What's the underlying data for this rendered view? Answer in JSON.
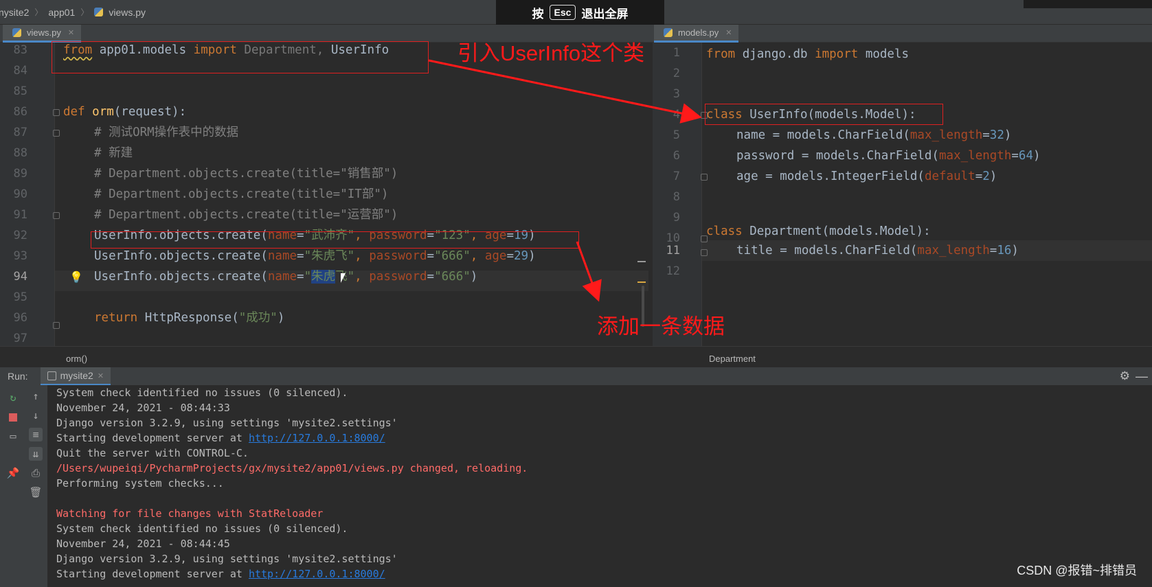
{
  "breadcrumb": {
    "project": "nysite2",
    "folder": "app01",
    "file": "views.py"
  },
  "overlay": {
    "press": "按",
    "key": "Esc",
    "action": "退出全屏"
  },
  "tabs": {
    "left": "views.py",
    "right": "models.py"
  },
  "left_editor": {
    "lines": [
      {
        "n": "83"
      },
      {
        "n": "84"
      },
      {
        "n": "85"
      },
      {
        "n": "86"
      },
      {
        "n": "87"
      },
      {
        "n": "88"
      },
      {
        "n": "89"
      },
      {
        "n": "90"
      },
      {
        "n": "91"
      },
      {
        "n": "92"
      },
      {
        "n": "93"
      },
      {
        "n": "94"
      },
      {
        "n": "95"
      },
      {
        "n": "96"
      },
      {
        "n": "97"
      }
    ],
    "code": {
      "l83_from": "from",
      "l83_mod": " app01.models ",
      "l83_import": "import",
      "l83_dept": " Department, ",
      "l83_user": "UserInfo",
      "l86_def": "def ",
      "l86_fn": "orm",
      "l86_rest": "(request):",
      "l87": "# 测试ORM操作表中的数据",
      "l88": "# 新建",
      "l89": "# Department.objects.create(title=\"销售部\")",
      "l90": "# Department.objects.create(title=\"IT部\")",
      "l91": "# Department.objects.create(title=\"运营部\")",
      "l92_a": "UserInfo.objects.create(",
      "l92_p1": "name",
      "l92_eq": "=",
      "l92_s1": "\"武沛齐\"",
      "l92_c": ", ",
      "l92_p2": "password",
      "l92_s2": "\"123\"",
      "l92_p3": "age",
      "l92_n": "19",
      "l92_close": ")",
      "l93_a": "UserInfo.objects.create(",
      "l93_p1": "name",
      "l93_s1": "\"朱虎飞\"",
      "l93_p2": "password",
      "l93_s2": "\"666\"",
      "l93_p3": "age",
      "l93_n": "29",
      "l93_close": ")",
      "l94_a": "UserInfo.objects.create(",
      "l94_p1": "name",
      "l94_q": "\"",
      "l94_sel": "朱虎",
      "l94_rest": "飞\"",
      "l94_p2": "password",
      "l94_s2": "\"666\"",
      "l94_close": ")",
      "l96_ret": "return ",
      "l96_a": "HttpResponse(",
      "l96_s": "\"成功\"",
      "l96_close": ")"
    }
  },
  "right_editor": {
    "lines": [
      {
        "n": "1"
      },
      {
        "n": "2"
      },
      {
        "n": "3"
      },
      {
        "n": "4"
      },
      {
        "n": "5"
      },
      {
        "n": "6"
      },
      {
        "n": "7"
      },
      {
        "n": "8"
      },
      {
        "n": "9"
      },
      {
        "n": "10"
      },
      {
        "n": "11"
      },
      {
        "n": "12"
      }
    ],
    "code": {
      "l1_from": "from",
      "l1_mod": " django.db ",
      "l1_import": "import",
      "l1_models": " models",
      "l4_class": "class ",
      "l4_rest": "UserInfo(models.Model):",
      "l5_a": "name = models.CharField(",
      "l5_p": "max_length",
      "l5_n": "32",
      "l6_a": "password = models.CharField(",
      "l6_p": "max_length",
      "l6_n": "64",
      "l7_a": "age = models.IntegerField(",
      "l7_p": "default",
      "l7_n": "2",
      "l10_class": "class ",
      "l10_rest": "Department(models.Model):",
      "l11_a": "title = models.CharField(",
      "l11_p": "max_length",
      "l11_n": "16"
    }
  },
  "annotations": {
    "import_note": "引入UserInfo这个类",
    "add_note": "添加一条数据"
  },
  "status": {
    "left": "orm()",
    "right": "Department"
  },
  "run": {
    "label": "Run:",
    "config": "mysite2"
  },
  "console": [
    {
      "text": "System check identified no issues (0 silenced).",
      "style": "normal"
    },
    {
      "text": "November 24, 2021 - 08:44:33",
      "style": "normal"
    },
    {
      "text": "Django version 3.2.9, using settings 'mysite2.settings'",
      "style": "normal"
    },
    {
      "text": "Starting development server at ",
      "link": "http://127.0.0.1:8000/",
      "style": "normal"
    },
    {
      "text": "Quit the server with CONTROL-C.",
      "style": "normal"
    },
    {
      "text": "/Users/wupeiqi/PycharmProjects/gx/mysite2/app01/views.py changed, reloading.",
      "style": "red"
    },
    {
      "text": "Performing system checks...",
      "style": "normal"
    },
    {
      "text": "",
      "style": "normal"
    },
    {
      "text": "Watching for file changes with StatReloader",
      "style": "red"
    },
    {
      "text": "System check identified no issues (0 silenced).",
      "style": "normal"
    },
    {
      "text": "November 24, 2021 - 08:44:45",
      "style": "normal"
    },
    {
      "text": "Django version 3.2.9, using settings 'mysite2.settings'",
      "style": "normal"
    },
    {
      "text": "Starting development server at ",
      "link": "http://127.0.0.1:8000/",
      "style": "normal"
    }
  ],
  "watermark": "CSDN @报错~排错员"
}
